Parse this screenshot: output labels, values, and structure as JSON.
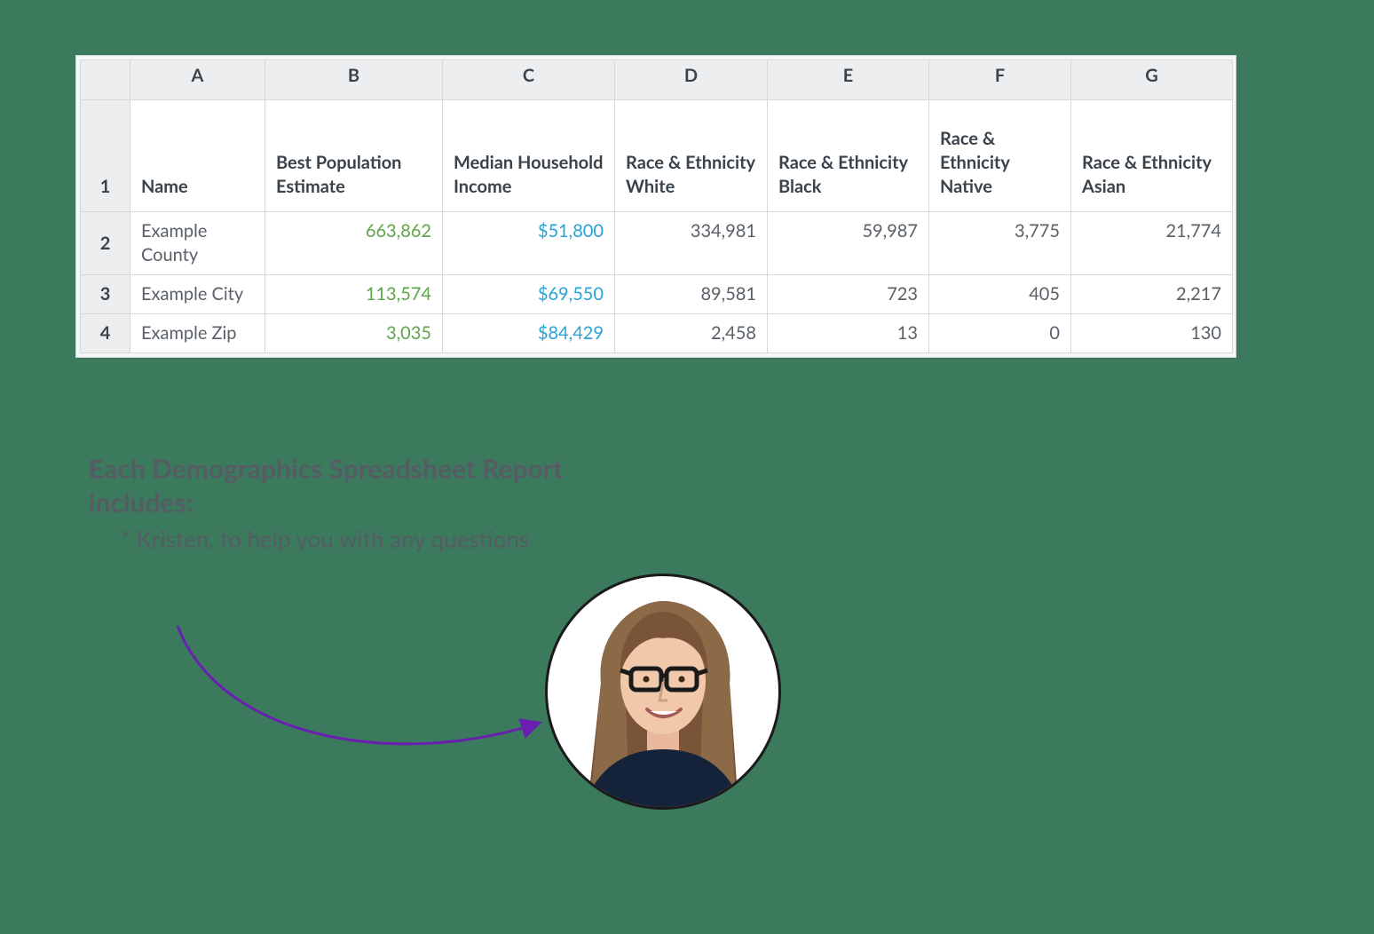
{
  "spreadsheet": {
    "col_letters": [
      "A",
      "B",
      "C",
      "D",
      "E",
      "F",
      "G"
    ],
    "row_numbers": [
      "1",
      "2",
      "3",
      "4"
    ],
    "headers": {
      "A": "Name",
      "B": "Best Population Estimate",
      "C": "Median Household Income",
      "D": "Race & Ethnicity White",
      "E": "Race & Ethnicity Black",
      "F": "Race & Ethnicity Native",
      "G": "Race & Ethnicity Asian"
    },
    "rows": [
      {
        "name": "Example County",
        "pop": "663,862",
        "income": "$51,800",
        "white": "334,981",
        "black": "59,987",
        "native": "3,775",
        "asian": "21,774"
      },
      {
        "name": "Example City",
        "pop": "113,574",
        "income": "$69,550",
        "white": "89,581",
        "black": "723",
        "native": "405",
        "asian": "2,217"
      },
      {
        "name": "Example Zip",
        "pop": "3,035",
        "income": "$84,429",
        "white": "2,458",
        "black": "13",
        "native": "0",
        "asian": "130"
      }
    ]
  },
  "caption": {
    "title": "Each Demographics Spreadsheet Report includes:",
    "bullet_prefix": "* ",
    "bullet_text": "Kristen, to help you with any questions"
  },
  "colors": {
    "background": "#3c7a5e",
    "pop_green": "#5fa54a",
    "income_blue": "#29a3d5",
    "arrow_purple": "#6a1fb1"
  }
}
